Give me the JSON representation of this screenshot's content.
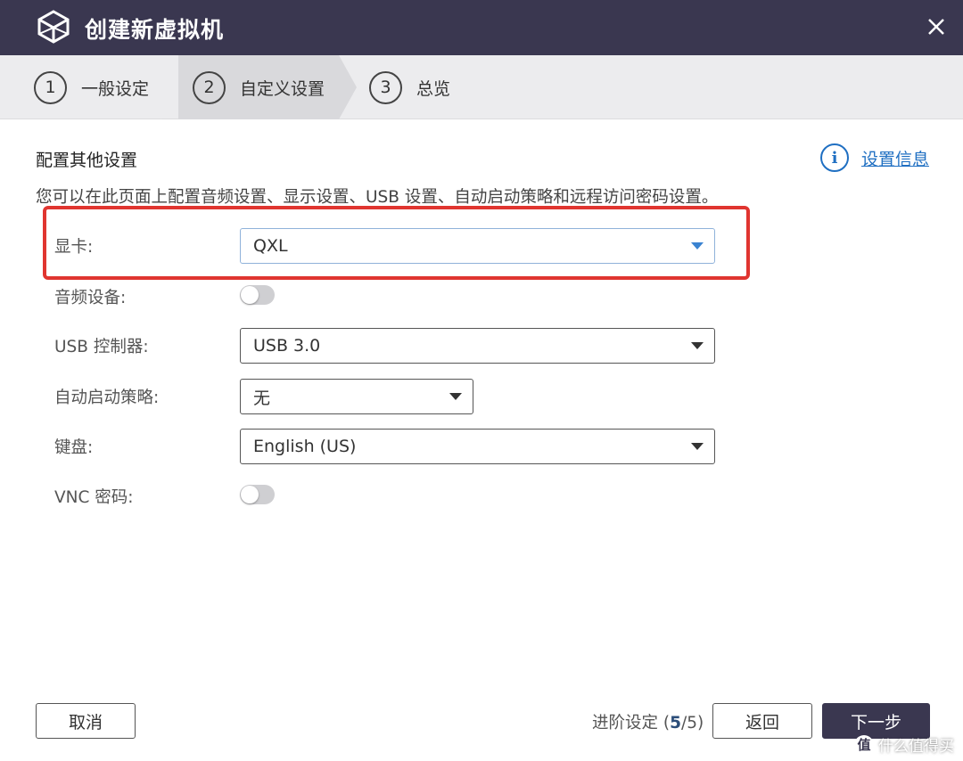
{
  "window": {
    "title": "创建新虚拟机",
    "close_icon": "close-icon",
    "app_icon": "virtual-machine-icon"
  },
  "steps": [
    {
      "number": "1",
      "label": "一般设定",
      "active": false
    },
    {
      "number": "2",
      "label": "自定义设置",
      "active": true
    },
    {
      "number": "3",
      "label": "总览",
      "active": false
    }
  ],
  "section": {
    "title": "配置其他设置",
    "info_link": "设置信息",
    "description": "您可以在此页面上配置音频设置、显示设置、USB 设置、自动启动策略和远程访问密码设置。"
  },
  "form": {
    "graphics_card": {
      "label": "显卡:",
      "value": "QXL"
    },
    "audio_device": {
      "label": "音频设备:",
      "enabled": false
    },
    "usb_controller": {
      "label": "USB 控制器:",
      "value": "USB 3.0"
    },
    "autostart_policy": {
      "label": "自动启动策略:",
      "value": "无"
    },
    "keyboard": {
      "label": "键盘:",
      "value": "English (US)"
    },
    "vnc_password": {
      "label": "VNC 密码:",
      "enabled": false
    }
  },
  "footer": {
    "cancel_label": "取消",
    "progress_prefix": "进阶设定 (",
    "progress_current": "5",
    "progress_suffix": "/5)",
    "back_label": "返回",
    "next_label": "下一步"
  },
  "watermark": {
    "logo": "值",
    "text": "什么值得买"
  },
  "colors": {
    "titlebar": "#3a3750",
    "accent_link": "#1f6fc2",
    "highlight_box": "#e03530",
    "primary_button": "#3a3750"
  }
}
